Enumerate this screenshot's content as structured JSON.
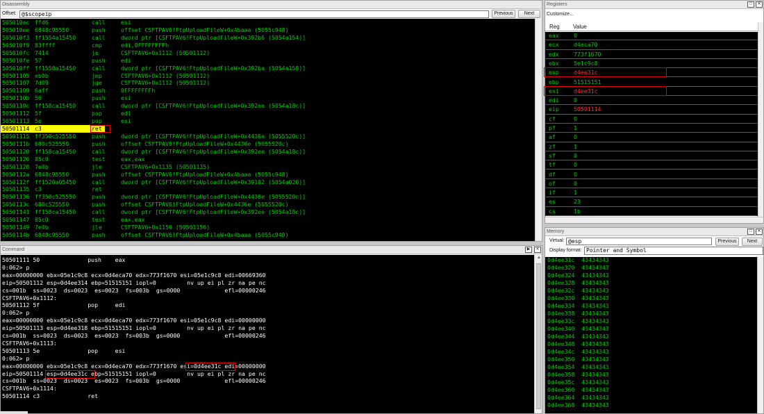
{
  "disassembly": {
    "title": "Disassembly",
    "offset_label": "Offset:",
    "offset_value": "@$scopeip",
    "prev_label": "Previous",
    "next_label": "Next",
    "rows": [
      {
        "addr": "505010ec",
        "bytes": "ffd6",
        "mn": "call",
        "ops": "esi"
      },
      {
        "addr": "505010ee",
        "bytes": "6848c95550",
        "mn": "push",
        "ops": "offset CSFTPAV6!FtpUploadFileW+0x4baaa (5055c948)"
      },
      {
        "addr": "505010f3",
        "bytes": "ff1554a15450",
        "mn": "call",
        "ops": "dword ptr [CSFTPAV6!FtpUploadFileW+0x392b6 (5054a154)]"
      },
      {
        "addr": "505010f9",
        "bytes": "83ffff",
        "mn": "cmp",
        "ops": "edi,0FFFFFFFFh"
      },
      {
        "addr": "505010fc",
        "bytes": "7414",
        "mn": "je",
        "ops": "CSFTPAV6+0x1112 (50501112)"
      },
      {
        "addr": "505010fe",
        "bytes": "57",
        "mn": "push",
        "ops": "edi"
      },
      {
        "addr": "505010ff",
        "bytes": "ff1558a15450",
        "mn": "call",
        "ops": "dword ptr [CSFTPAV6!FtpUploadFileW+0x392ba (5054a158)]"
      },
      {
        "addr": "50501105",
        "bytes": "eb0b",
        "mn": "jmp",
        "ops": "CSFTPAV6+0x1112 (50501112)"
      },
      {
        "addr": "50501107",
        "bytes": "7d09",
        "mn": "jge",
        "ops": "CSFTPAV6+0x1112 (50501112)"
      },
      {
        "addr": "50501109",
        "bytes": "6aff",
        "mn": "push",
        "ops": "0FFFFFFFFh"
      },
      {
        "addr": "5050110b",
        "bytes": "56",
        "mn": "push",
        "ops": "esi"
      },
      {
        "addr": "5050110c",
        "bytes": "ff158ca15450",
        "mn": "call",
        "ops": "dword ptr [CSFTPAV6!FtpUploadFileW+0x392ee (5054a18c)]"
      },
      {
        "addr": "50501112",
        "bytes": "5f",
        "mn": "pop",
        "ops": "edi"
      },
      {
        "addr": "50501113",
        "bytes": "5e",
        "mn": "pop",
        "ops": "esi"
      },
      {
        "addr": "50501114",
        "bytes": "c3",
        "mn": "ret",
        "ops": ""
      },
      {
        "addr": "50501115",
        "bytes": "ff350c525550",
        "mn": "push",
        "ops": "dword ptr [CSFTPAV6!FtpUploadFileW+0x4436e (5055520c)]"
      },
      {
        "addr": "5050111b",
        "bytes": "680c525550",
        "mn": "push",
        "ops": "offset CSFTPAV6!FtpUploadFileW+0x4436e (5055520c)"
      },
      {
        "addr": "50501120",
        "bytes": "ff158ca15450",
        "mn": "call",
        "ops": "dword ptr [CSFTPAV6!FtpUploadFileW+0x392ee (5054a18c)]"
      },
      {
        "addr": "50501126",
        "bytes": "85c0",
        "mn": "test",
        "ops": "eax,eax"
      },
      {
        "addr": "50501128",
        "bytes": "7e0b",
        "mn": "jle",
        "ops": "CSFTPAV6+0x1135 (50501135)"
      },
      {
        "addr": "5050112a",
        "bytes": "6848c95550",
        "mn": "push",
        "ops": "offset CSFTPAV6!FtpUploadFileW+0x4baaa (5055c948)"
      },
      {
        "addr": "5050112f",
        "bytes": "ff1520a05450",
        "mn": "call",
        "ops": "dword ptr [CSFTPAV6!FtpUploadFileW+0x39182 (5054a020)]"
      },
      {
        "addr": "50501135",
        "bytes": "c3",
        "mn": "ret",
        "ops": ""
      },
      {
        "addr": "50501136",
        "bytes": "ff350c525550",
        "mn": "push",
        "ops": "dword ptr [CSFTPAV6!FtpUploadFileW+0x4436e (5055520c)]"
      },
      {
        "addr": "5050113c",
        "bytes": "680c525550",
        "mn": "push",
        "ops": "offset CSFTPAV6!FtpUploadFileW+0x4436e (5055520c)"
      },
      {
        "addr": "50501141",
        "bytes": "ff158ca15450",
        "mn": "call",
        "ops": "dword ptr [CSFTPAV6!FtpUploadFileW+0x392ee (5054a18c)]"
      },
      {
        "addr": "50501147",
        "bytes": "85c0",
        "mn": "test",
        "ops": "eax,eax"
      },
      {
        "addr": "50501149",
        "bytes": "7e0b",
        "mn": "jle",
        "ops": "CSFTPAV6+0x1156 (50501156)"
      },
      {
        "addr": "5050114b",
        "bytes": "6848c95550",
        "mn": "push",
        "ops": "offset CSFTPAV6!FtpUploadFileW+0x4baaa (5055c948)"
      }
    ]
  },
  "command": {
    "title": "Command",
    "lines": [
      "50501111 50              push    eax",
      "0:062> p",
      "eax=00000000 ebx=05e1c9c8 ecx=0d4eca70 edx=773f1670 esi=05e1c9c8 edi=00669360",
      "eip=50501112 esp=0d4ee314 ebp=51515151 iopl=0         nv up ei pl zr na pe nc",
      "cs=001b  ss=0023  ds=0023  es=0023  fs=003b  gs=0000             efl=00000246",
      "CSFTPAV6+0x1112:",
      "50501112 5f              pop     edi",
      "0:062> p",
      "eax=00000000 ebx=05e1c9c8 ecx=0d4eca70 edx=773f1670 esi=05e1c9c8 edi=00000000",
      "eip=50501113 esp=0d4ee318 ebp=51515151 iopl=0         nv up ei pl zr na pe nc",
      "cs=001b  ss=0023  ds=0023  es=0023  fs=003b  gs=0000             efl=00000246",
      "CSFTPAV6+0x1113:",
      "50501113 5e              pop     esi",
      "0:062> p",
      "eax=00000000 ebx=05e1c9c8 ecx=0d4eca70 edx=773f1670 esi=0d4ee31c edi=00000000",
      "eip=50501114 esp=0d4ee31c ebp=51515151 iopl=0         nv up ei pl zr na pe nc",
      "cs=001b  ss=0023  ds=0023  es=0023  fs=003b  gs=0000             efl=00000246",
      "CSFTPAV6+0x1114:",
      "50501114 c3              ret"
    ]
  },
  "registers": {
    "title": "Registers",
    "customize_label": "Customize...",
    "col_reg": "Reg",
    "col_value": "Value",
    "rows": [
      {
        "reg": "eax",
        "value": "0",
        "changed": false
      },
      {
        "reg": "ecx",
        "value": "d4eca70",
        "changed": false
      },
      {
        "reg": "edx",
        "value": "773f1670",
        "changed": false
      },
      {
        "reg": "ebx",
        "value": "5e1c9c8",
        "changed": false
      },
      {
        "reg": "esp",
        "value": "d4ee31c",
        "changed": true
      },
      {
        "reg": "ebp",
        "value": "51515151",
        "changed": false
      },
      {
        "reg": "esi",
        "value": "d4ee31c",
        "changed": true
      },
      {
        "reg": "edi",
        "value": "0",
        "changed": false
      },
      {
        "reg": "eip",
        "value": "50501114",
        "changed": true
      },
      {
        "reg": "cf",
        "value": "0",
        "changed": false
      },
      {
        "reg": "pf",
        "value": "1",
        "changed": false
      },
      {
        "reg": "af",
        "value": "0",
        "changed": false
      },
      {
        "reg": "zf",
        "value": "1",
        "changed": false
      },
      {
        "reg": "sf",
        "value": "0",
        "changed": false
      },
      {
        "reg": "tf",
        "value": "0",
        "changed": false
      },
      {
        "reg": "df",
        "value": "0",
        "changed": false
      },
      {
        "reg": "of",
        "value": "0",
        "changed": false
      },
      {
        "reg": "if",
        "value": "1",
        "changed": false
      },
      {
        "reg": "es",
        "value": "23",
        "changed": false
      },
      {
        "reg": "cs",
        "value": "1b",
        "changed": false
      }
    ]
  },
  "memory": {
    "title": "Memory",
    "virtual_label": "Virtual:",
    "virtual_value": "@esp",
    "display_format_label": "Display format:",
    "display_format_value": "Pointer and Symbol",
    "prev_label": "Previous",
    "next_label": "Next",
    "lines": [
      "0d4ee31c  43434343",
      "0d4ee320  43434343",
      "0d4ee324  43434343",
      "0d4ee328  43434343",
      "0d4ee32c  43434343",
      "0d4ee330  43434343",
      "0d4ee334  43434343",
      "0d4ee338  43434343",
      "0d4ee33c  43434343",
      "0d4ee340  43434343",
      "0d4ee344  43434343",
      "0d4ee348  43434343",
      "0d4ee34c  43434343",
      "0d4ee350  43434343",
      "0d4ee354  43434343",
      "0d4ee358  43434343",
      "0d4ee35c  43434343",
      "0d4ee360  43434343",
      "0d4ee364  43434343",
      "0d4ee368  43434343"
    ]
  },
  "colors": {
    "code_green": "#00d000",
    "highlight_yellow": "#ffff00",
    "annotation_red": "#e00000",
    "changed_red": "#ff3030"
  }
}
